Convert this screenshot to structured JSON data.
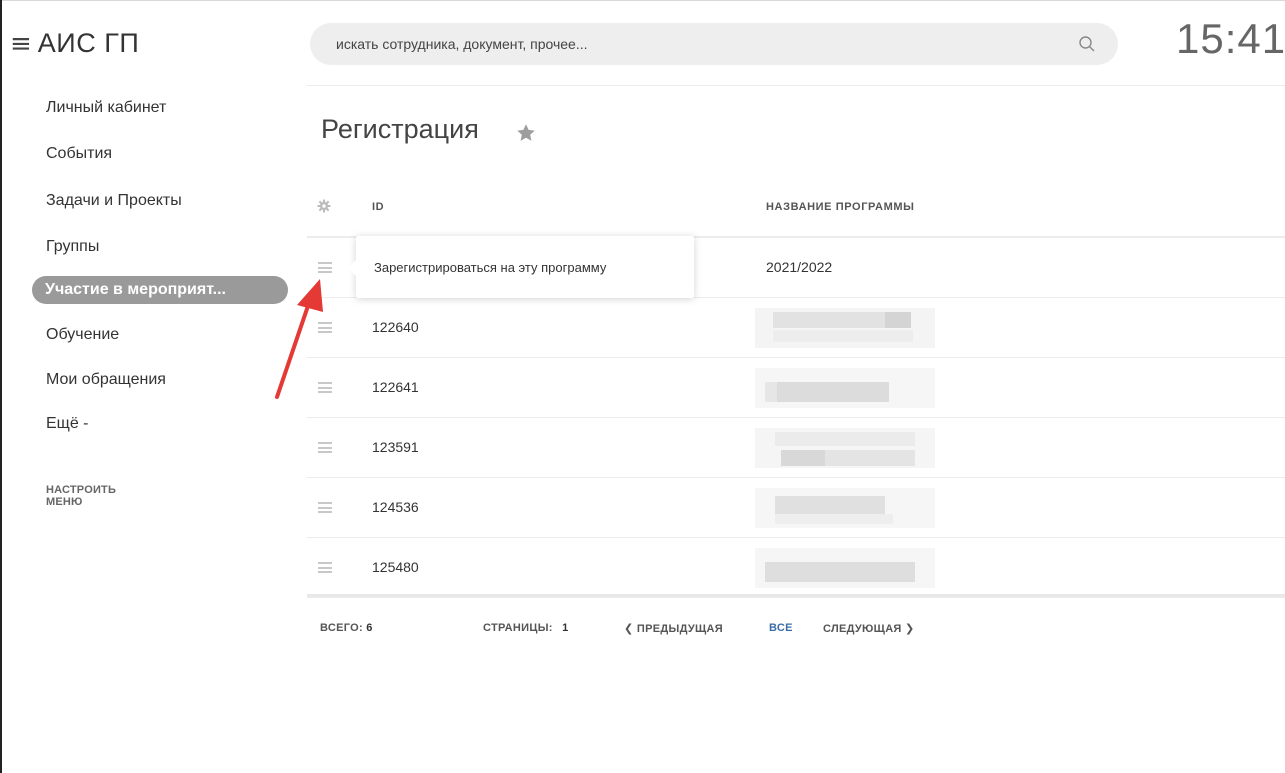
{
  "header": {
    "app_title": "АИС ГП",
    "search_placeholder": "искать сотрудника, документ, прочее...",
    "clock": "15:41"
  },
  "sidebar": {
    "items": [
      {
        "label": "Личный кабинет"
      },
      {
        "label": "События"
      },
      {
        "label": "Задачи и Проекты"
      },
      {
        "label": "Группы"
      },
      {
        "label": "Участие в мероприят..."
      },
      {
        "label": "Обучение"
      },
      {
        "label": "Мои обращения"
      },
      {
        "label": "Ещё -"
      }
    ],
    "configure_label": "НАСТРОИТЬ МЕНЮ"
  },
  "page": {
    "title": "Регистрация"
  },
  "table": {
    "columns": [
      "ID",
      "НАЗВАНИЕ ПРОГРАММЫ"
    ],
    "rows": [
      {
        "id": "",
        "name": "2021/2022"
      },
      {
        "id": "122640",
        "name": ""
      },
      {
        "id": "122641",
        "name": ""
      },
      {
        "id": "123591",
        "name": ""
      },
      {
        "id": "124536",
        "name": ""
      },
      {
        "id": "125480",
        "name": ""
      }
    ]
  },
  "tooltip": {
    "text": "Зарегистрироваться на эту программу"
  },
  "pagination": {
    "total_label": "ВСЕГО:",
    "total_value": "6",
    "pages_label": "СТРАНИЦЫ:",
    "pages_value": "1",
    "prev_label": "ПРЕДЫДУЩАЯ",
    "all_label": "ВСЕ",
    "next_label": "СЛЕДУЮЩАЯ"
  },
  "colors": {
    "active_item_bg": "#9a9a9a",
    "annotation_arrow": "#e53935",
    "link": "#3a6ea5"
  }
}
